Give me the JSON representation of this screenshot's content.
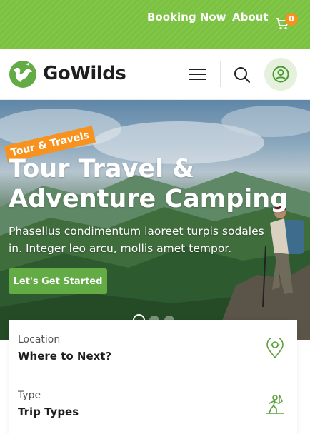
{
  "topbar": {
    "links": [
      "Booking Now",
      "About"
    ],
    "cart_count": "0",
    "cart_icon": "cart-icon",
    "accent": "#7cc241"
  },
  "header": {
    "logo_text": "GoWilds",
    "menu_icon": "hamburger-icon",
    "search_icon": "search-icon",
    "user_icon": "user-icon"
  },
  "hero": {
    "tag": "Tour & Travels",
    "title": "Tour Travel & Adventure Camping",
    "description": "Phasellus condimentum laoreet turpis sodales in. Integer leo arcu, mollis amet tempor.",
    "cta": "Let's Get Started",
    "slides": 3,
    "active_slide": 1
  },
  "search_card": {
    "fields": [
      {
        "label": "Location",
        "value": "Where to Next?",
        "icon": "map-pin-icon"
      },
      {
        "label": "Type",
        "value": "Trip Types",
        "icon": "hiker-icon"
      }
    ]
  },
  "colors": {
    "brand_green": "#63ab45",
    "accent_orange": "#f7921e"
  }
}
